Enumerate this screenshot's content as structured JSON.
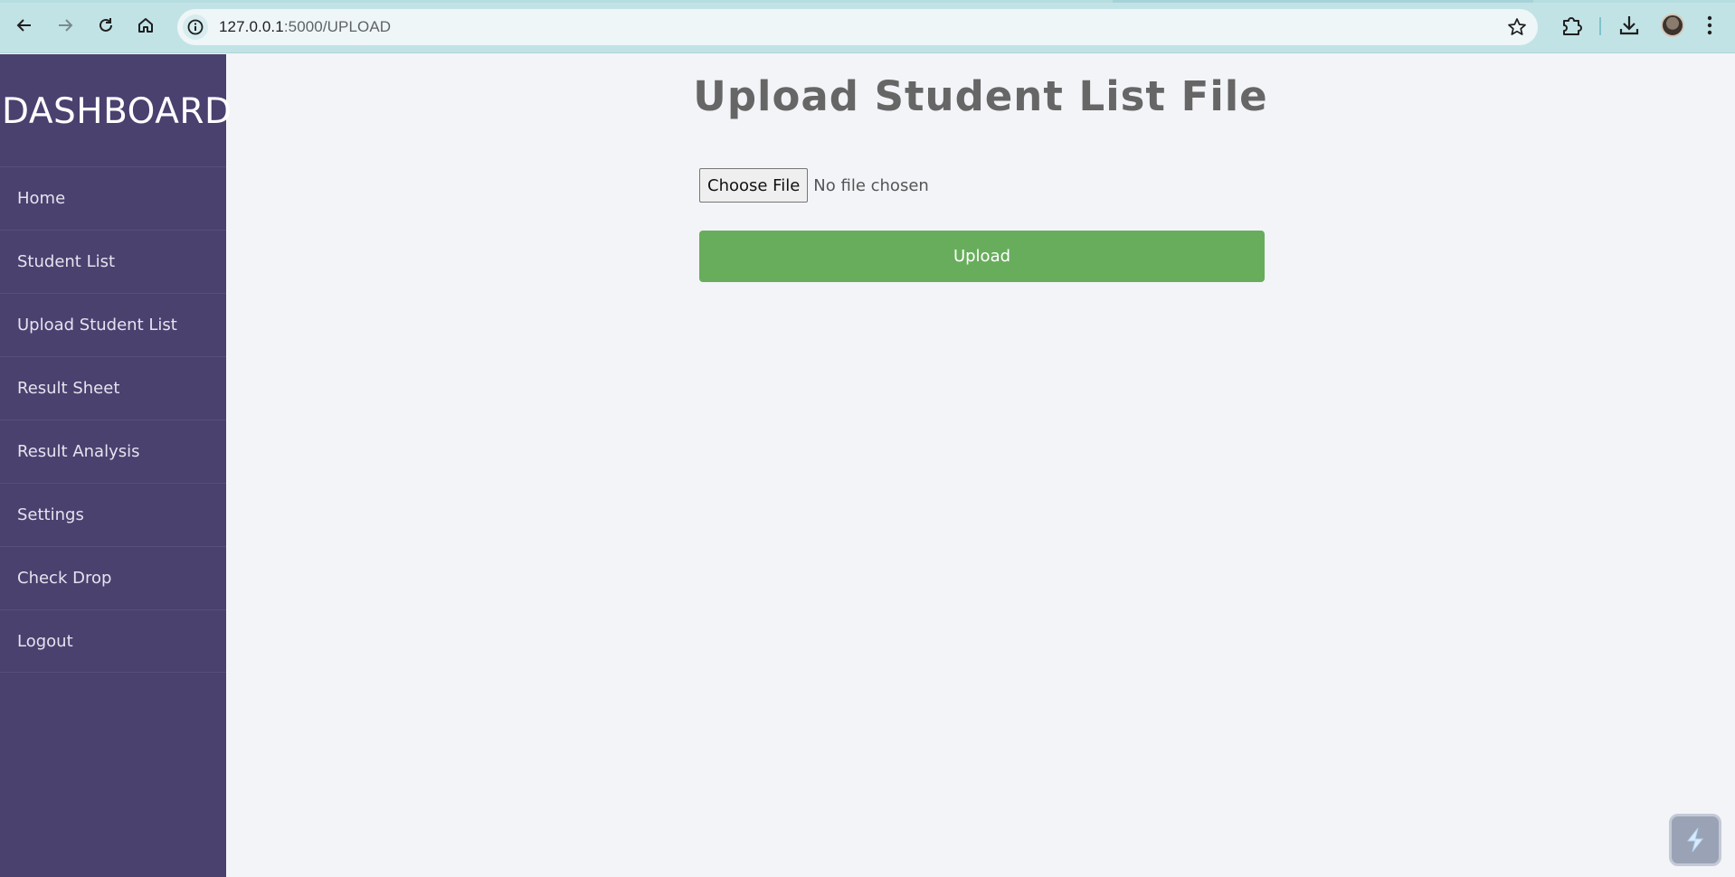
{
  "browser": {
    "url_host": "127.0.0.1",
    "url_rest": ":5000/UPLOAD"
  },
  "sidebar": {
    "brand": "DASHBOARD",
    "items": [
      {
        "label": "Home"
      },
      {
        "label": "Student List"
      },
      {
        "label": "Upload Student List"
      },
      {
        "label": "Result Sheet"
      },
      {
        "label": "Result Analysis"
      },
      {
        "label": "Settings"
      },
      {
        "label": "Check Drop"
      },
      {
        "label": "Logout"
      }
    ]
  },
  "main": {
    "title": "Upload Student List File",
    "choose_file_label": "Choose File",
    "file_status": "No file chosen",
    "upload_label": "Upload"
  },
  "colors": {
    "sidebar_bg": "#4a416f",
    "upload_button": "#68ad5c",
    "page_bg": "#f3f4f8",
    "chrome_bg": "#c2e3e6"
  },
  "icons": {
    "back": "arrow-left-icon",
    "forward": "arrow-right-icon",
    "reload": "reload-icon",
    "home": "home-icon",
    "info": "info-icon",
    "bookmark": "star-icon",
    "extensions": "puzzle-icon",
    "downloads": "download-icon",
    "menu": "kebab-menu-icon",
    "widget": "lightning-icon"
  }
}
